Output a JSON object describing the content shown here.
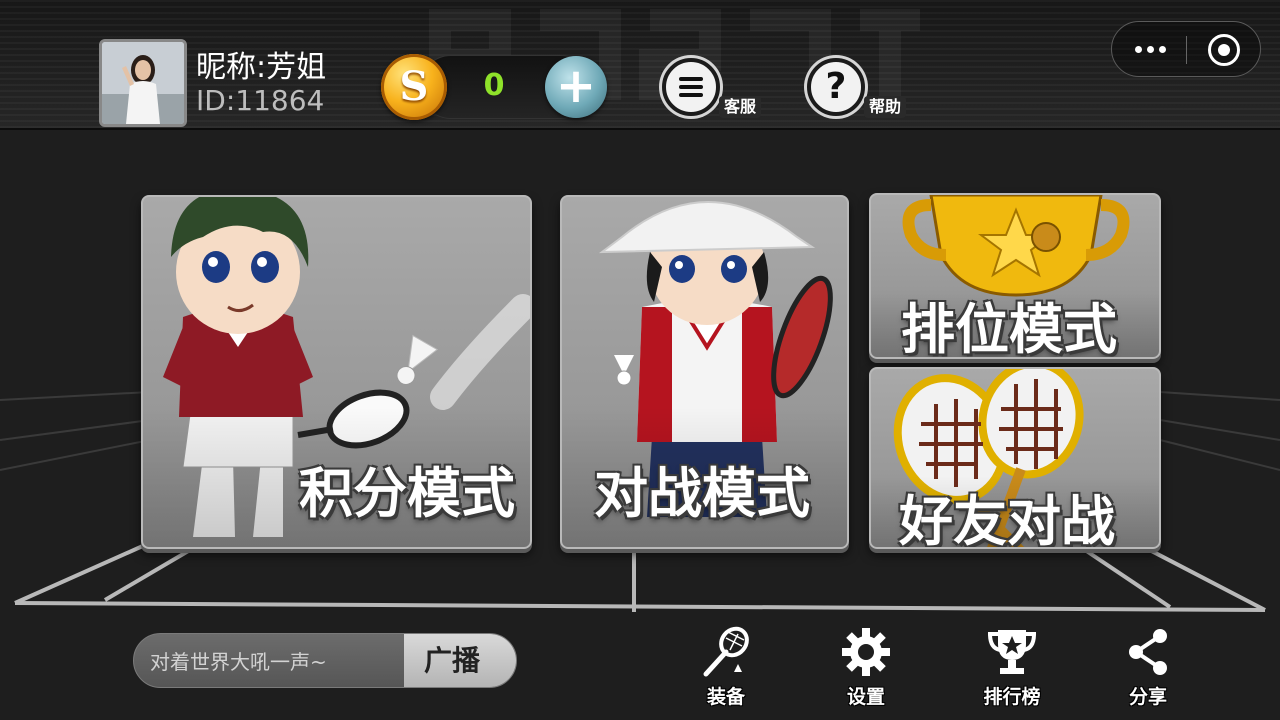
{
  "header": {
    "nickname": "昵称:芳姐",
    "user_id": "ID:11864",
    "coin_symbol": "S",
    "coin_count": "0",
    "add_coin_symbol": "+",
    "customer_service_label": "客服",
    "help_label": "帮助",
    "help_symbol": "?"
  },
  "modes": {
    "score": "积分模式",
    "battle": "对战模式",
    "rank": "排位模式",
    "friend": "好友对战"
  },
  "bottom": {
    "broadcast_placeholder": "对着世界大吼一声~",
    "broadcast_button": "广播",
    "nav": {
      "equip": "装备",
      "settings": "设置",
      "leaderboard": "排行榜",
      "share": "分享"
    }
  },
  "colors": {
    "coin_count": "#8fe22a",
    "coin": "#f8b21c",
    "add_button": "#6fa9b7"
  },
  "icons": [
    "coin-icon",
    "add-icon",
    "customer-service-icon",
    "help-icon",
    "more-icon",
    "close-icon",
    "racket-icon",
    "gear-icon",
    "trophy-icon",
    "share-icon"
  ]
}
